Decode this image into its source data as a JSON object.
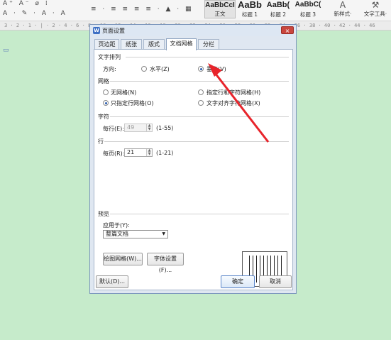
{
  "toolbar": {
    "row1_icons": "A⁺ A⁻ ⌀ ⁞",
    "row2_icons": "A · ✎ · A · A",
    "para_icons": "≡ · ≡ ≡ ≡ ≡ · ▲ · ▦",
    "styles": [
      {
        "sample": "AaBbCcI",
        "name": "正文"
      },
      {
        "sample": "AaBb",
        "name": "标题 1"
      },
      {
        "sample": "AaBb(",
        "name": "标题 2"
      },
      {
        "sample": "AaBbC(",
        "name": "标题 3"
      }
    ],
    "new_style_label": "新样式·",
    "text_tools_label": "文字工具·"
  },
  "ruler": {
    "ticks": "3 · 2 · 1 · | · 2 · 4 · 6 · 8 · 10 · 12 · 14 · 16 · 18 · 20 · 22 · 24 · 26 · 28 · 30 · 32 · 34 · 36 · 38 · 40 · 42 · 44 · 46"
  },
  "dialog": {
    "title": "页面设置",
    "close": "×",
    "tabs": [
      "页边距",
      "纸张",
      "版式",
      "文档网格",
      "分栏"
    ],
    "active_tab": "文档网格",
    "text_direction": {
      "section": "文字排列",
      "direction_label": "方向:",
      "horizontal": "水平(Z)",
      "vertical": "垂直(V)",
      "selected": "垂直(V)"
    },
    "grid": {
      "section": "网格",
      "options": [
        "无网格(N)",
        "只指定行网格(O)",
        "指定行和字符网格(H)",
        "文字对齐字符网格(X)"
      ],
      "selected": "只指定行网格(O)"
    },
    "chars": {
      "section": "字符",
      "per_line_label": "每行(E):",
      "per_line_value": "49",
      "range": "(1-55)"
    },
    "lines": {
      "section": "行",
      "per_page_label": "每页(R):",
      "per_page_value": "21",
      "range": "(1-21)"
    },
    "preview": {
      "section": "预览",
      "apply_label": "应用于(Y):",
      "apply_value": "整篇文档"
    },
    "buttons": {
      "draw_grid": "绘图网格(W)...",
      "font_settings": "字体设置(F)...",
      "default": "默认(D)...",
      "ok": "确定",
      "cancel": "取消"
    }
  },
  "colors": {
    "background": "#c6ebcb",
    "dialog": "#dfe7f1",
    "arrow": "#e8242b",
    "close": "#c9463d"
  }
}
